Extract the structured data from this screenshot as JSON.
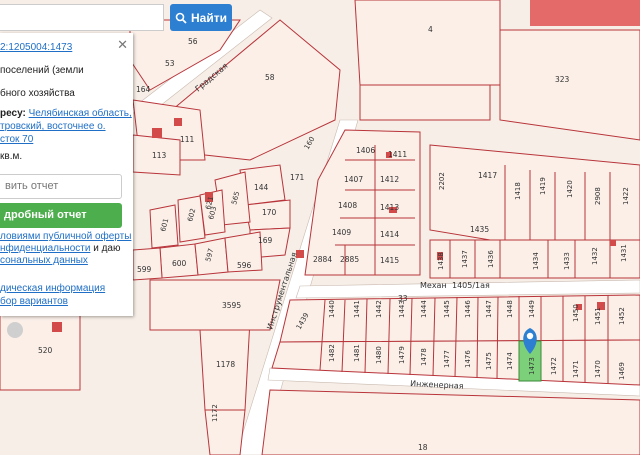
{
  "search": {
    "button_label": "Найти",
    "value": ""
  },
  "panel": {
    "cadastral_link": "2:1205004:1473",
    "category_line1": "поселений (земли",
    "category_line2": "бного хозяйства",
    "address_prefix": "ресу:",
    "address_link_1": "Челябинская область,",
    "address_link_2": "тровский, восточнее о.",
    "address_link_3": "сток 70",
    "area_unit": "кв.м.",
    "order_placeholder": "вить отчет",
    "detailed_button": "дробный отчет",
    "terms_1_link": "ловиями публичной оферты",
    "terms_2_link": "нфиденциальности",
    "terms_2_tail": " и даю",
    "terms_3_link": "сональных данных",
    "info_link": "дическая информация",
    "options_link": "бор вариантов"
  },
  "map": {
    "streets": {
      "gradskaya": "Градская",
      "instrumentalnaya": "Инструментальная",
      "mekh": "Механ",
      "mekh_tail": "1405/1ая",
      "inzhenernaya": "Инженерная"
    },
    "parcel_labels": [
      "56",
      "53",
      "4",
      "323",
      "58",
      "164",
      "111",
      "113",
      "1406",
      "1411",
      "1407",
      "1412",
      "1408",
      "1413",
      "1409",
      "1414",
      "2884",
      "2885",
      "1415",
      "2202",
      "1417",
      "1418",
      "1419",
      "1420",
      "2908",
      "1421",
      "1422",
      "1435",
      "1436",
      "1437",
      "1438",
      "1434",
      "1433",
      "1432",
      "1431",
      "1430",
      "144",
      "170",
      "169",
      "160",
      "565",
      "603",
      "621",
      "601",
      "602",
      "600",
      "597",
      "596",
      "599",
      "3595",
      "1439",
      "1440",
      "1441",
      "1442",
      "1443",
      "1444",
      "1445",
      "1446",
      "1447",
      "1448",
      "1449",
      "1450",
      "1451",
      "1452",
      "1482",
      "1481",
      "1480",
      "1479",
      "1478",
      "1477",
      "1476",
      "1475",
      "1474",
      "1473",
      "1472",
      "1471",
      "1470",
      "1469",
      "1178",
      "1172",
      "520",
      "18",
      "33"
    ],
    "highlight_color": "#7cd07a",
    "marker_color": "#2c7fd1"
  }
}
